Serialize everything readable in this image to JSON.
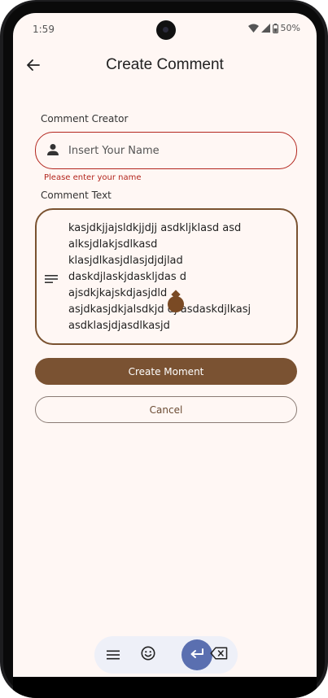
{
  "status_bar": {
    "time": "1:59",
    "battery": "50%"
  },
  "app_bar": {
    "title": "Create Comment",
    "back_icon": "arrow-back-icon"
  },
  "form": {
    "creator_label": "Comment Creator",
    "creator_placeholder": "Insert Your Name",
    "creator_icon": "person-icon",
    "creator_error": "Please enter your name",
    "text_label": "Comment Text",
    "text_icon": "notes-icon",
    "text_value": "kasjdkjjajsldkjjdjj asdkljklasd asd\nalksjdlakjsdlkasd\nklasjdlkasjdlasjdjdjlad\ndaskdjlaskjdaskljdas d\najsdkjkajskdjasjdld\nasjdkasjdkjalsdkjd dj asdaskdjlkasj\nasdklasjdjasdlkasjd"
  },
  "buttons": {
    "primary": "Create Moment",
    "secondary": "Cancel"
  },
  "keyboard_toolbar": {
    "icons": [
      "menu-icon",
      "emoji-icon",
      "enter-icon",
      "backspace-icon"
    ]
  },
  "colors": {
    "background": "#fff7f4",
    "primary": "#7a5232",
    "error": "#b3261e",
    "outline": "#7a5230",
    "enter_key": "#5a6fb0"
  }
}
